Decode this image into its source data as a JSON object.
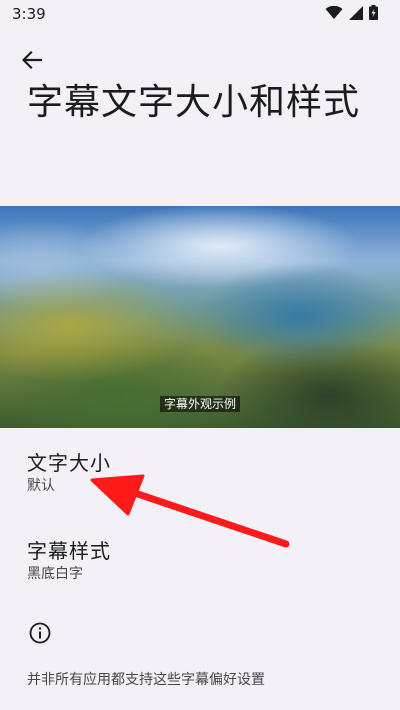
{
  "status_bar": {
    "time": "3:39",
    "icons": [
      "wifi-icon",
      "signal-icon",
      "battery-icon"
    ]
  },
  "header": {
    "back_icon": "back-arrow-icon",
    "title": "字幕文字大小和样式"
  },
  "preview": {
    "caption": "字幕外观示例"
  },
  "settings": [
    {
      "title": "文字大小",
      "summary": "默认"
    },
    {
      "title": "字幕样式",
      "summary": "黑底白字"
    }
  ],
  "footer": {
    "icon": "info-icon",
    "note": "并非所有应用都支持这些字幕偏好设置"
  },
  "colors": {
    "background": "#f3f1f7",
    "text_primary": "#1c1b1f",
    "text_secondary": "#49454f",
    "annotation": "#ff1a1a"
  }
}
